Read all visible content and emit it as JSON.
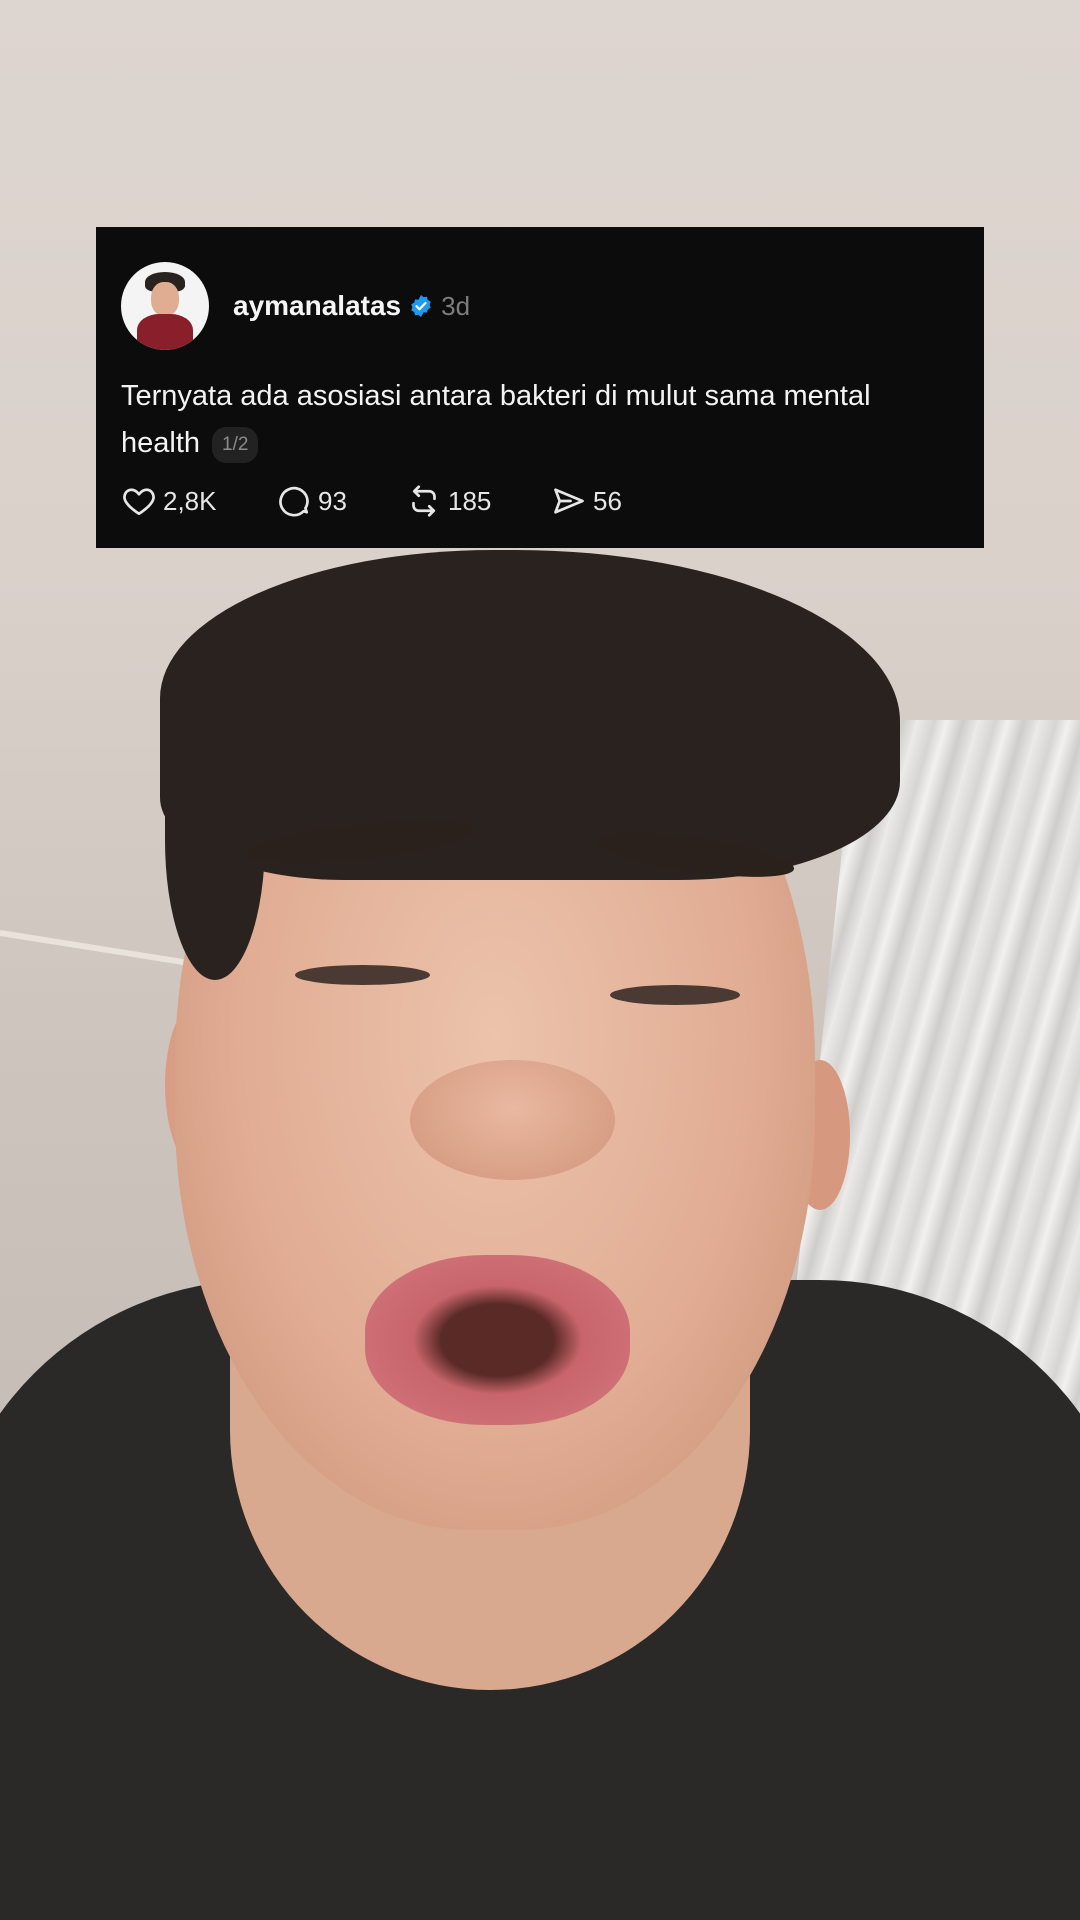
{
  "post": {
    "username": "aymanalatas",
    "time": "3d",
    "text": "Ternyata ada asosiasi antara bakteri di mulut sama mental health",
    "page_indicator": "1/2",
    "likes": "2,8K",
    "replies": "93",
    "reposts": "185",
    "shares": "56"
  },
  "icons": {
    "verified": "verified-badge-icon",
    "like": "heart-icon",
    "reply": "speech-bubble-icon",
    "repost": "repost-icon",
    "share": "send-icon"
  },
  "colors": {
    "card_background": "#0c0c0c",
    "verified_blue": "#1d9bf0",
    "muted_text": "#7d7d7d"
  }
}
